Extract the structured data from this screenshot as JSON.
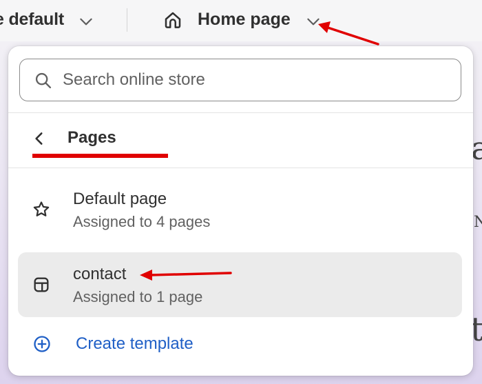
{
  "topbar": {
    "theme_label": "e default",
    "page_label": "Home page"
  },
  "search": {
    "placeholder": "Search online store"
  },
  "section": {
    "title": "Pages"
  },
  "templates": [
    {
      "title": "Default page",
      "subtitle": "Assigned to 4 pages",
      "icon": "star-icon",
      "selected": false
    },
    {
      "title": "contact",
      "subtitle": "Assigned to 1 page",
      "icon": "layout-icon",
      "selected": true
    }
  ],
  "create": {
    "label": "Create template"
  },
  "background": {
    "glyph_a": "a",
    "glyph_n": "N",
    "glyph_t": "t"
  },
  "colors": {
    "accent_link": "#1f5fc6",
    "annotation": "#e00000",
    "selected_row": "#ebebeb"
  }
}
